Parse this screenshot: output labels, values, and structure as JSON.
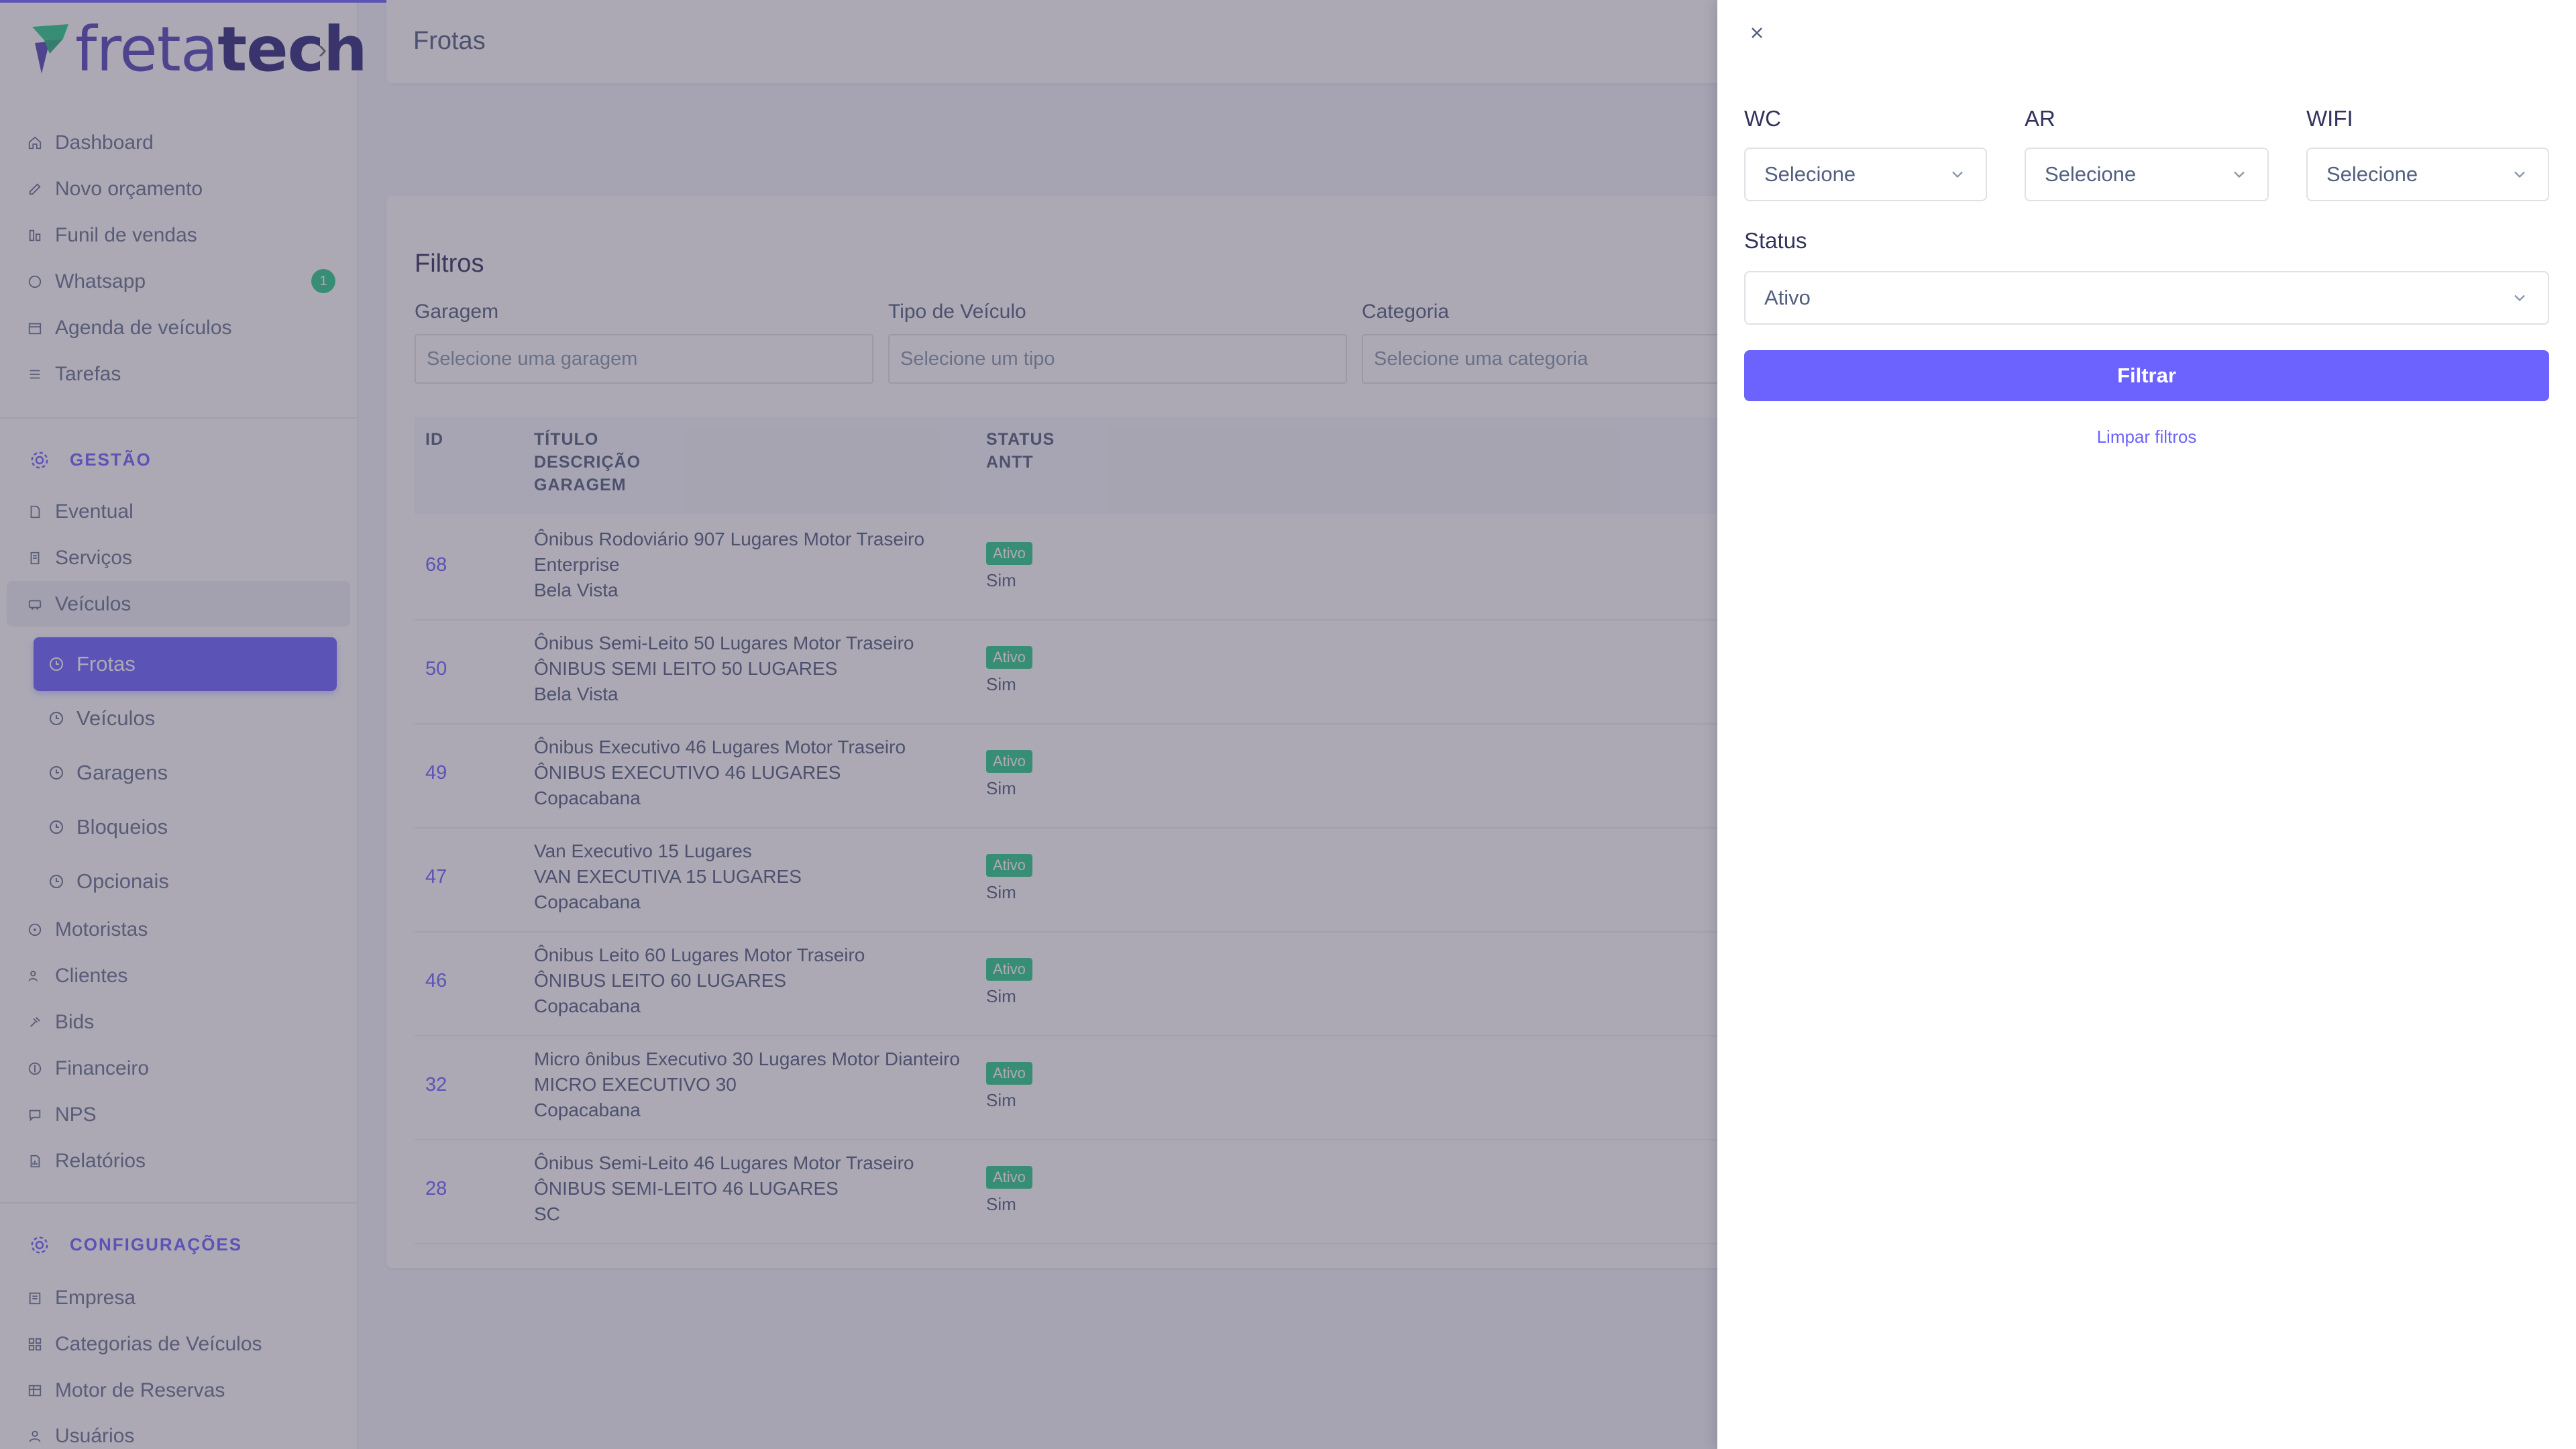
{
  "app": {
    "logo_text_a": "freta",
    "logo_text_b": "tech"
  },
  "sidebar": {
    "items": [
      {
        "label": "Dashboard",
        "icon": "home-icon"
      },
      {
        "label": "Novo orçamento",
        "icon": "edit-icon"
      },
      {
        "label": "Funil de vendas",
        "icon": "funnel-icon"
      },
      {
        "label": "Whatsapp",
        "icon": "whatsapp-icon",
        "badge": "1"
      },
      {
        "label": "Agenda de veículos",
        "icon": "calendar-icon"
      },
      {
        "label": "Tarefas",
        "icon": "list-icon"
      }
    ],
    "gestao": {
      "title": "GESTÃO",
      "items": [
        {
          "label": "Eventual"
        },
        {
          "label": "Serviços"
        },
        {
          "label": "Veículos"
        }
      ],
      "subitems": [
        {
          "label": "Frotas",
          "active": true
        },
        {
          "label": "Veículos"
        },
        {
          "label": "Garagens"
        },
        {
          "label": "Bloqueios"
        },
        {
          "label": "Opcionais"
        }
      ],
      "items2": [
        {
          "label": "Motoristas"
        },
        {
          "label": "Clientes"
        },
        {
          "label": "Bids"
        },
        {
          "label": "Financeiro"
        },
        {
          "label": "NPS"
        },
        {
          "label": "Relatórios"
        }
      ]
    },
    "config": {
      "title": "CONFIGURAÇÕES",
      "items": [
        {
          "label": "Empresa"
        },
        {
          "label": "Categorias de Veículos"
        },
        {
          "label": "Motor de Reservas"
        },
        {
          "label": "Usuários"
        }
      ]
    }
  },
  "page": {
    "title": "Frotas"
  },
  "filters": {
    "title": "Filtros",
    "garagem": {
      "label": "Garagem",
      "placeholder": "Selecione uma garagem"
    },
    "tipo": {
      "label": "Tipo de Veículo",
      "placeholder": "Selecione um tipo"
    },
    "categoria": {
      "label": "Categoria",
      "placeholder": "Selecione uma categoria"
    }
  },
  "table": {
    "headers": {
      "id": "ID",
      "titulo": "TÍTULO",
      "descricao": "DESCRIÇÃO",
      "garagem": "GARAGEM",
      "status": "STATUS",
      "antt": "ANTT"
    },
    "rows": [
      {
        "id": "68",
        "titulo": "Ônibus Rodoviário 907 Lugares Motor Traseiro",
        "descricao": "Enterprise",
        "garagem": "Bela Vista",
        "status": "Ativo",
        "antt": "Sim"
      },
      {
        "id": "50",
        "titulo": "Ônibus Semi-Leito 50 Lugares Motor Traseiro",
        "descricao": "ÔNIBUS SEMI LEITO 50 LUGARES",
        "garagem": "Bela Vista",
        "status": "Ativo",
        "antt": "Sim"
      },
      {
        "id": "49",
        "titulo": "Ônibus Executivo 46 Lugares Motor Traseiro",
        "descricao": "ÔNIBUS EXECUTIVO 46 LUGARES",
        "garagem": "Copacabana",
        "status": "Ativo",
        "antt": "Sim"
      },
      {
        "id": "47",
        "titulo": "Van Executivo 15 Lugares",
        "descricao": "VAN EXECUTIVA 15 LUGARES",
        "garagem": "Copacabana",
        "status": "Ativo",
        "antt": "Sim"
      },
      {
        "id": "46",
        "titulo": "Ônibus Leito 60 Lugares Motor Traseiro",
        "descricao": "ÔNIBUS LEITO 60 LUGARES",
        "garagem": "Copacabana",
        "status": "Ativo",
        "antt": "Sim"
      },
      {
        "id": "32",
        "titulo": "Micro ônibus Executivo 30 Lugares Motor Dianteiro",
        "descricao": "MICRO EXECUTIVO 30",
        "garagem": "Copacabana",
        "status": "Ativo",
        "antt": "Sim"
      },
      {
        "id": "28",
        "titulo": "Ônibus Semi-Leito 46 Lugares Motor Traseiro",
        "descricao": "ÔNIBUS SEMI-LEITO 46 LUGARES",
        "garagem": "SC",
        "status": "Ativo",
        "antt": "Sim"
      }
    ]
  },
  "drawer": {
    "wc": {
      "label": "WC",
      "value": "Selecione"
    },
    "ar": {
      "label": "AR",
      "value": "Selecione"
    },
    "wifi": {
      "label": "WIFI",
      "value": "Selecione"
    },
    "status": {
      "label": "Status",
      "value": "Ativo"
    },
    "filtrar_label": "Filtrar",
    "limpar_label": "Limpar filtros"
  },
  "colors": {
    "accent": "#6c63ff",
    "success": "#2dce89",
    "text": "#525f7f"
  }
}
